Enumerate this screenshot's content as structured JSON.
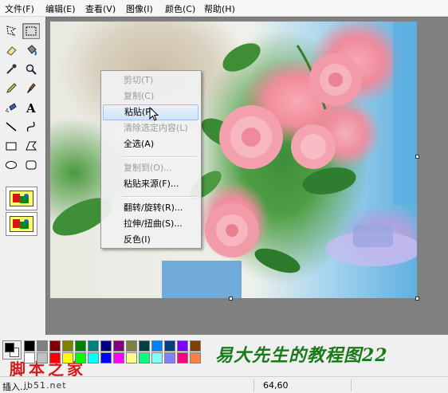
{
  "menu": [
    "文件(F)",
    "编辑(E)",
    "查看(V)",
    "图像(I)",
    "颜色(C)",
    "帮助(H)"
  ],
  "tools": [
    "free-select-icon",
    "rect-select-icon",
    "eraser-icon",
    "fill-bucket-icon",
    "color-picker-icon",
    "magnifier-icon",
    "pencil-icon",
    "brush-icon",
    "airbrush-icon",
    "text-icon",
    "line-icon",
    "curve-icon",
    "rectangle-icon",
    "polygon-icon",
    "ellipse-icon",
    "rounded-rect-icon"
  ],
  "active_tool": "rect-select-icon",
  "context_menu": {
    "items": [
      {
        "label": "剪切(T)",
        "enabled": false
      },
      {
        "label": "复制(C)",
        "enabled": false
      },
      {
        "label": "粘贴(P)",
        "enabled": true,
        "highlighted": true
      },
      {
        "label": "清除选定内容(L)",
        "enabled": false
      },
      {
        "label": "全选(A)",
        "enabled": true
      },
      {
        "separator": true
      },
      {
        "label": "复制到(O)...",
        "enabled": false
      },
      {
        "label": "粘贴来源(F)...",
        "enabled": true
      },
      {
        "separator": true
      },
      {
        "label": "翻转/旋转(R)...",
        "enabled": true
      },
      {
        "label": "拉伸/扭曲(S)...",
        "enabled": true
      },
      {
        "label": "反色(I)",
        "enabled": true
      }
    ]
  },
  "palette": {
    "foreground": "#000000",
    "background": "#ffffff",
    "row1": [
      "#000000",
      "#808080",
      "#800000",
      "#808000",
      "#008000",
      "#008080",
      "#000080",
      "#800080",
      "#808040",
      "#004040",
      "#0080ff",
      "#004080",
      "#8000ff",
      "#804000"
    ],
    "row2": [
      "#ffffff",
      "#c0c0c0",
      "#ff0000",
      "#ffff00",
      "#00ff00",
      "#00ffff",
      "#0000ff",
      "#ff00ff",
      "#ffff80",
      "#00ff80",
      "#80ffff",
      "#8080ff",
      "#ff0080",
      "#ff8040"
    ]
  },
  "watermark_title": "易大先生的教程图22",
  "site_logo": "脚本之家",
  "status": {
    "help_text": "插入...",
    "site_url": "jb51.net",
    "coordinates": "64,60"
  },
  "colors": {
    "workspace": "#808080",
    "menu_highlight": "#cfe3f8",
    "watermark": "#1a7a1a",
    "logo": "#d61a1a"
  }
}
